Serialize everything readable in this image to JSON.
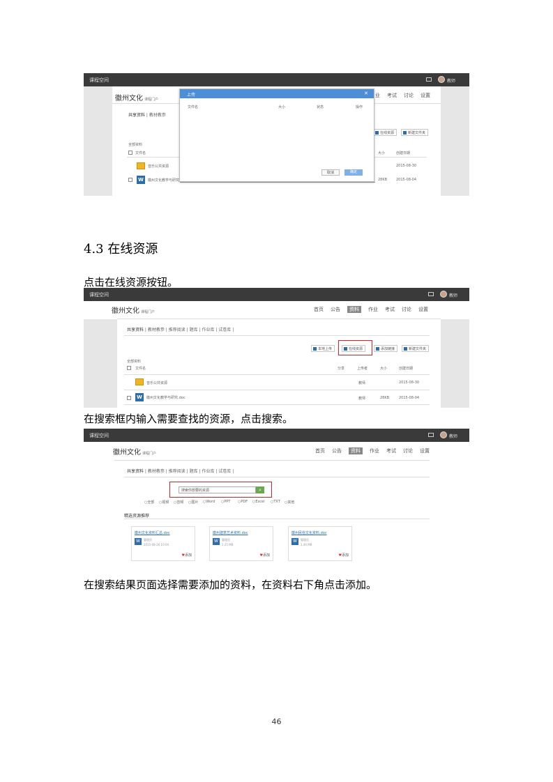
{
  "screenshot1": {
    "brand": "课程空间",
    "user": "教师",
    "course_title": "徽州文化",
    "course_subtitle": "课程门户",
    "nav": [
      "业",
      "考试",
      "讨论",
      "设置"
    ],
    "tabs": [
      "共享资料",
      "教材教参"
    ],
    "folder_label": "全部资料",
    "col_file": "文件名",
    "col_size": "大小",
    "col_date": "创建日期",
    "btn_left": "在线资源",
    "btn_right": "新建文件夹",
    "rows": [
      {
        "name": "音乐公共资源",
        "date": "2015-08-30"
      },
      {
        "name": "徽州文化教学与研究",
        "size": "28KB",
        "date": "2015-08-04"
      }
    ],
    "dialog": {
      "title": "上传",
      "close": "✕",
      "headers": [
        "文件名",
        "大小",
        "状态",
        "操作"
      ],
      "cancel": "取消",
      "ok": "确定"
    }
  },
  "heading": "4.3 在线资源",
  "para1": "点击在线资源按钮。",
  "screenshot2": {
    "brand": "课程空间",
    "user": "教师",
    "course_title": "徽州文化",
    "course_subtitle": "课程门户",
    "nav": [
      "首页",
      "公告",
      "资料",
      "作业",
      "考试",
      "讨论",
      "设置"
    ],
    "active_nav": "资料",
    "tabs": [
      "共享资料",
      "教材教参",
      "推荐阅读",
      "题库",
      "作业库",
      "试卷库"
    ],
    "buttons": [
      "本地上传",
      "在线资源",
      "添加链接",
      "新建文件夹"
    ],
    "folder_label": "全部资料",
    "col_file": "文件名",
    "col_share": "分享",
    "col_uploader": "上传者",
    "col_size": "大小",
    "col_date": "创建日期",
    "rows": [
      {
        "name": "音乐公共资源",
        "uploader": "教师",
        "size": "",
        "date": "2015-08-30"
      },
      {
        "name": "徽州文化教学与研究.doc",
        "uploader": "教师",
        "size": "28KB",
        "date": "2015-08-04"
      }
    ]
  },
  "para2": "在搜索框内输入需要查找的资源，点击搜索。",
  "screenshot3": {
    "brand": "课程空间",
    "user": "教师",
    "course_title": "徽州文化",
    "course_subtitle": "课程门户",
    "nav": [
      "首页",
      "公告",
      "资料",
      "作业",
      "考试",
      "讨论",
      "设置"
    ],
    "active_nav": "资料",
    "tabs": [
      "共享资料",
      "教材教参",
      "推荐阅读",
      "题库",
      "作业库",
      "试卷库"
    ],
    "search_placeholder": "搜索你想要的资源",
    "filters": [
      "全部",
      "视频",
      "音频",
      "图片",
      "Word",
      "PPT",
      "PDF",
      "Excel",
      "TXT",
      "其他"
    ],
    "section_title": "精选资源推荐",
    "cards": [
      {
        "title": "徽州文化资料汇总.doc",
        "by": "管理员",
        "date": "2015-08-26 10:04",
        "add": "添加"
      },
      {
        "title": "徽州建筑艺术资料.doc",
        "by": "管理员",
        "size": "1.25 MB",
        "add": "添加"
      },
      {
        "title": "徽州民俗文化资料.doc",
        "by": "管理员",
        "size": "1.44 MB",
        "add": "添加"
      }
    ]
  },
  "para3": "在搜索结果页面选择需要添加的资料，在资料右下角点击添加。",
  "page_number": "46"
}
